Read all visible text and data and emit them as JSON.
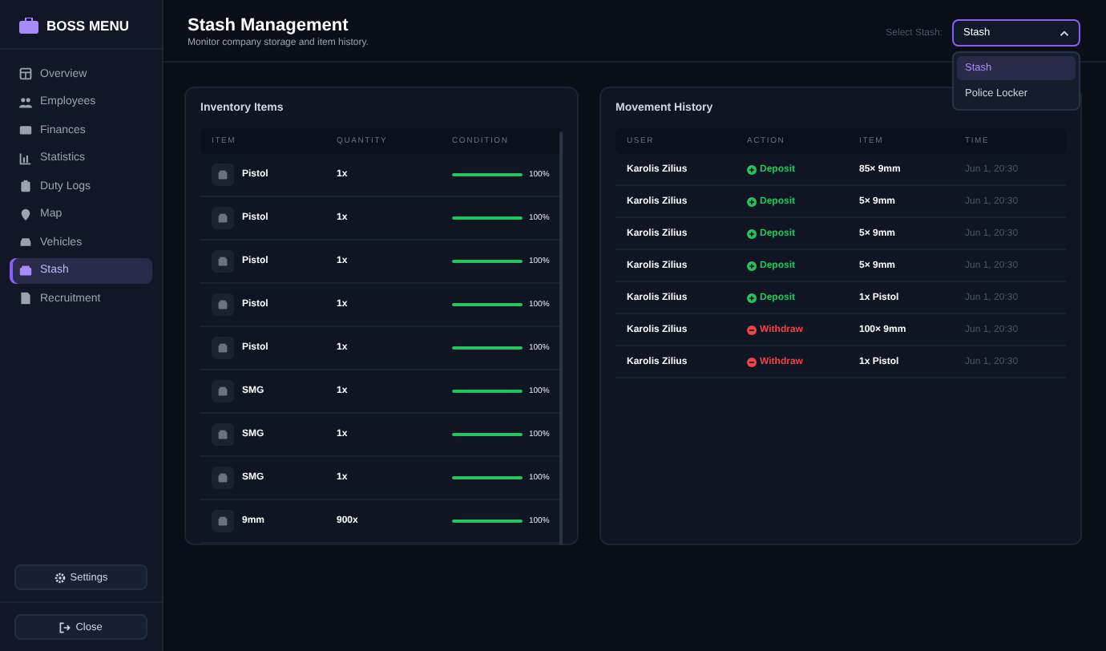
{
  "sidebar": {
    "title": "BOSS MENU",
    "items": [
      {
        "label": "Overview",
        "selected": false
      },
      {
        "label": "Employees",
        "selected": false
      },
      {
        "label": "Finances",
        "selected": false
      },
      {
        "label": "Statistics",
        "selected": false
      },
      {
        "label": "Duty Logs",
        "selected": false
      },
      {
        "label": "Map",
        "selected": false
      },
      {
        "label": "Vehicles",
        "selected": false
      },
      {
        "label": "Stash",
        "selected": true
      },
      {
        "label": "Recruitment",
        "selected": false
      }
    ],
    "settings": "Settings",
    "close": "Close"
  },
  "header": {
    "title": "Stash Management",
    "subtitle": "Monitor company storage and item history.",
    "select_label": "Select Stash:",
    "select_value": "Stash",
    "dropdown": [
      {
        "label": "Stash",
        "selected": true
      },
      {
        "label": "Police Locker",
        "selected": false
      }
    ]
  },
  "inventory": {
    "title": "Inventory Items",
    "columns": [
      "ITEM",
      "QUANTITY",
      "CONDITION"
    ],
    "rows": [
      {
        "name": "Pistol",
        "quantity": "1x",
        "level": 1,
        "reading": "100%"
      },
      {
        "name": "Pistol",
        "quantity": "1x",
        "level": 1,
        "reading": "100%"
      },
      {
        "name": "Pistol",
        "quantity": "1x",
        "level": 1,
        "reading": "100%"
      },
      {
        "name": "Pistol",
        "quantity": "1x",
        "level": 1,
        "reading": "100%"
      },
      {
        "name": "Pistol",
        "quantity": "1x",
        "level": 1,
        "reading": "100%"
      },
      {
        "name": "SMG",
        "quantity": "1x",
        "level": 1,
        "reading": "100%"
      },
      {
        "name": "SMG",
        "quantity": "1x",
        "level": 1,
        "reading": "100%"
      },
      {
        "name": "SMG",
        "quantity": "1x",
        "level": 1,
        "reading": "100%"
      },
      {
        "name": "9mm",
        "quantity": "900x",
        "level": 1,
        "reading": "100%"
      }
    ]
  },
  "history": {
    "title": "Movement History",
    "columns": [
      "USER",
      "ACTION",
      "ITEM",
      "TIME"
    ],
    "rows": [
      {
        "user": "Karolis Zilius",
        "action": {
          "kind": "deposit",
          "label": "Deposit"
        },
        "item": "85× 9mm",
        "time": "Jun 1, 20:30"
      },
      {
        "user": "Karolis Zilius",
        "action": {
          "kind": "deposit",
          "label": "Deposit"
        },
        "item": "5× 9mm",
        "time": "Jun 1, 20:30"
      },
      {
        "user": "Karolis Zilius",
        "action": {
          "kind": "deposit",
          "label": "Deposit"
        },
        "item": "5× 9mm",
        "time": "Jun 1, 20:30"
      },
      {
        "user": "Karolis Zilius",
        "action": {
          "kind": "deposit",
          "label": "Deposit"
        },
        "item": "5× 9mm",
        "time": "Jun 1, 20:30"
      },
      {
        "user": "Karolis Zilius",
        "action": {
          "kind": "deposit",
          "label": "Deposit"
        },
        "item": "1x Pistol",
        "time": "Jun 1, 20:30"
      },
      {
        "user": "Karolis Zilius",
        "action": {
          "kind": "withdraw",
          "label": "Withdraw"
        },
        "item": "100× 9mm",
        "time": "Jun 1, 20:30"
      },
      {
        "user": "Karolis Zilius",
        "action": {
          "kind": "withdraw",
          "label": "Withdraw"
        },
        "item": "1x Pistol",
        "time": "Jun 1, 20:30"
      }
    ]
  }
}
